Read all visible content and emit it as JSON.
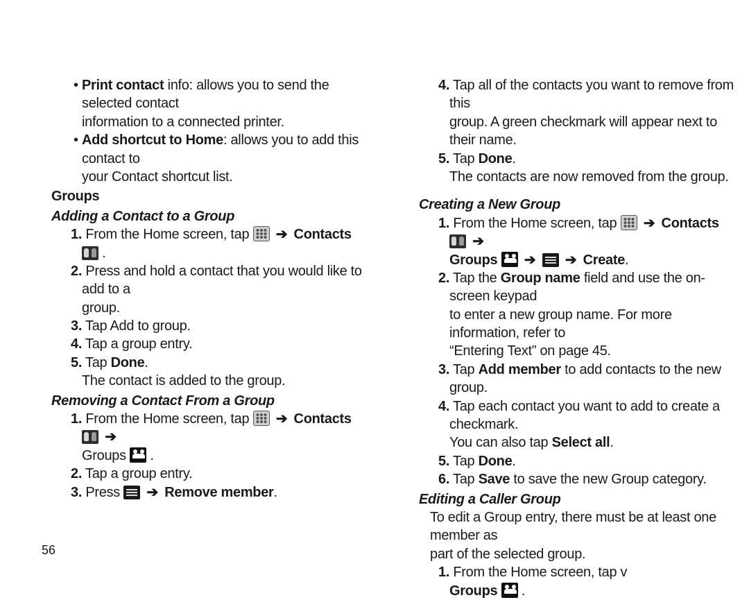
{
  "left": {
    "bullets": [
      {
        "lead": "Print contact",
        "rest": " info: allows you to send the selected contact",
        "cont": "information to a connected printer."
      },
      {
        "lead": "Add shortcut to Home",
        "rest": ": allows you to add this contact to",
        "cont": "your Contact shortcut list."
      }
    ],
    "groups_heading": "Groups",
    "topic1": "Adding a Contact to a Group",
    "t1_s1_a": "1.",
    "t1_s1_b": "From the Home screen, tap ",
    "t1_s1_c": " Contacts ",
    "t1_s1_d": ".",
    "t1_s2_a": "2.",
    "t1_s2_b": "Press and hold a contact that you would like to add to a",
    "t1_s2_c": "group.",
    "t1_s3_a": "3.",
    "t1_s3_b": "Tap Add to group.",
    "t1_s4_a": "4.",
    "t1_s4_b": "Tap a group entry.",
    "t1_s5_a": "5.",
    "t1_s5_b": "Tap ",
    "t1_s5_c": "Done",
    "t1_s5_d": ".",
    "t1_s5_e": "The contact is added to the group.",
    "topic2": "Removing a Contact From a Group",
    "t2_s1_a": "1.",
    "t2_s1_b": "From the Home screen, tap ",
    "t2_s1_c": " Contacts ",
    "t2_s1_d": "Groups ",
    "t2_s1_e": ".",
    "t2_s2_a": "2.",
    "t2_s2_b": "Tap a group entry.",
    "t2_s3_a": "3.",
    "t2_s3_b": "Press ",
    "t2_s3_c": " Remove member",
    "t2_s3_d": ".",
    "page": "56"
  },
  "right": {
    "r1_s4_a": "4.",
    "r1_s4_b": "Tap all of the contacts you want to remove from this",
    "r1_s4_c": "group. A green checkmark will appear next to their name.",
    "r1_s5_a": "5.",
    "r1_s5_b": "Tap ",
    "r1_s5_c": "Done",
    "r1_s5_d": ".",
    "r1_s5_e": "The contacts are now removed from the group.",
    "topic3": "Creating a New Group",
    "t3_s1_a": "1.",
    "t3_s1_b": "From the Home screen, tap ",
    "t3_s1_c": " Contacts ",
    "t3_s1_d": "Groups ",
    "t3_s1_e": " Create",
    "t3_s1_f": ".",
    "t3_s2_a": "2.",
    "t3_s2_b": "Tap the ",
    "t3_s2_c": "Group name",
    "t3_s2_d": " field and use the on-screen keypad",
    "t3_s2_e": "to enter a new group name. For more information, refer to",
    "t3_s2_f": "“Entering Text” on page 45.",
    "t3_s3_a": "3.",
    "t3_s3_b": "Tap ",
    "t3_s3_c": "Add member",
    "t3_s3_d": " to add contacts to the new group.",
    "t3_s4_a": "4.",
    "t3_s4_b": "Tap each contact you want to add to create a checkmark.",
    "t3_s4_c": "You can also tap ",
    "t3_s4_d": "Select all",
    "t3_s4_e": ".",
    "t3_s5_a": "5.",
    "t3_s5_b": "Tap ",
    "t3_s5_c": "Done",
    "t3_s5_d": ".",
    "t3_s6_a": "6.",
    "t3_s6_b": "Tap ",
    "t3_s6_c": "Save",
    "t3_s6_d": " to save the new Group category.",
    "topic4": "Editing a Caller Group",
    "t4_intro_a": "To edit a Group entry, there must be at least one member as",
    "t4_intro_b": "part of the selected group.",
    "t4_s1_a": "1.",
    "t4_s1_b": "From the Home screen, tap v",
    "t4_s1_c": "Groups ",
    "t4_s1_d": "."
  },
  "glyphs": {
    "arrow": "➔"
  }
}
